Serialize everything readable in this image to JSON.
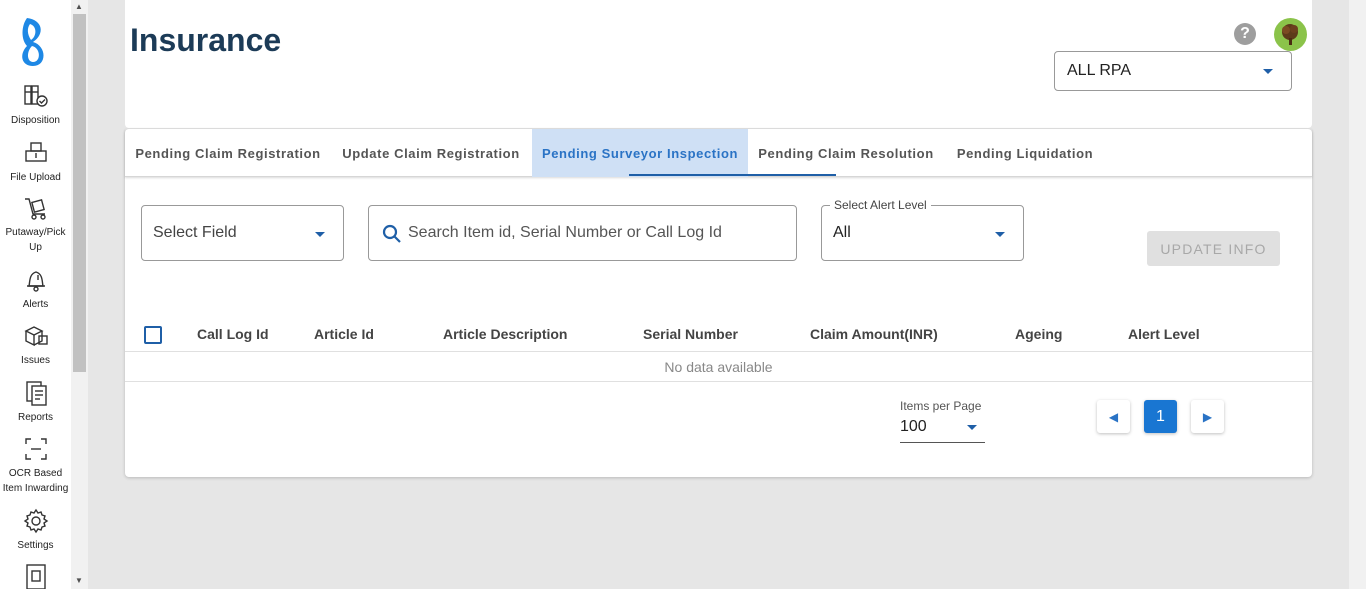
{
  "sidebar": {
    "items": [
      {
        "label": "Disposition",
        "icon": "disposition-icon"
      },
      {
        "label": "File Upload",
        "icon": "file-upload-icon"
      },
      {
        "label": "Putaway/Pick Up",
        "icon": "cart-icon"
      },
      {
        "label": "Alerts",
        "icon": "bell-icon"
      },
      {
        "label": "Issues",
        "icon": "boxes-icon"
      },
      {
        "label": "Reports",
        "icon": "report-icon"
      },
      {
        "label": "OCR Based Item Inwarding",
        "icon": "scan-icon"
      },
      {
        "label": "Settings",
        "icon": "gear-icon"
      }
    ]
  },
  "header": {
    "title": "Insurance",
    "help": "?",
    "rpa_select": {
      "value": "ALL RPA"
    }
  },
  "tabs": [
    {
      "label": "Pending Claim Registration",
      "active": false
    },
    {
      "label": "Update Claim Registration",
      "active": false
    },
    {
      "label": "Pending Surveyor Inspection",
      "active": true
    },
    {
      "label": "Pending Claim Resolution",
      "active": false
    },
    {
      "label": "Pending Liquidation",
      "active": false
    }
  ],
  "filters": {
    "select_field": {
      "placeholder": "Select Field"
    },
    "search": {
      "placeholder": "Search Item id, Serial Number or Call Log Id"
    },
    "alert_level": {
      "label": "Select Alert Level",
      "value": "All"
    },
    "update_button": "UPDATE INFO"
  },
  "table": {
    "columns": [
      "Call Log Id",
      "Article Id",
      "Article Description",
      "Serial Number",
      "Claim Amount(INR)",
      "Ageing",
      "Alert Level"
    ],
    "rows": [],
    "empty_text": "No data available"
  },
  "pagination": {
    "items_per_page_label": "Items per Page",
    "items_per_page": "100",
    "current_page": "1"
  },
  "colors": {
    "accent": "#1f5fa7",
    "title": "#1c3b57",
    "active_tab_bg": "#cfe0f5"
  }
}
